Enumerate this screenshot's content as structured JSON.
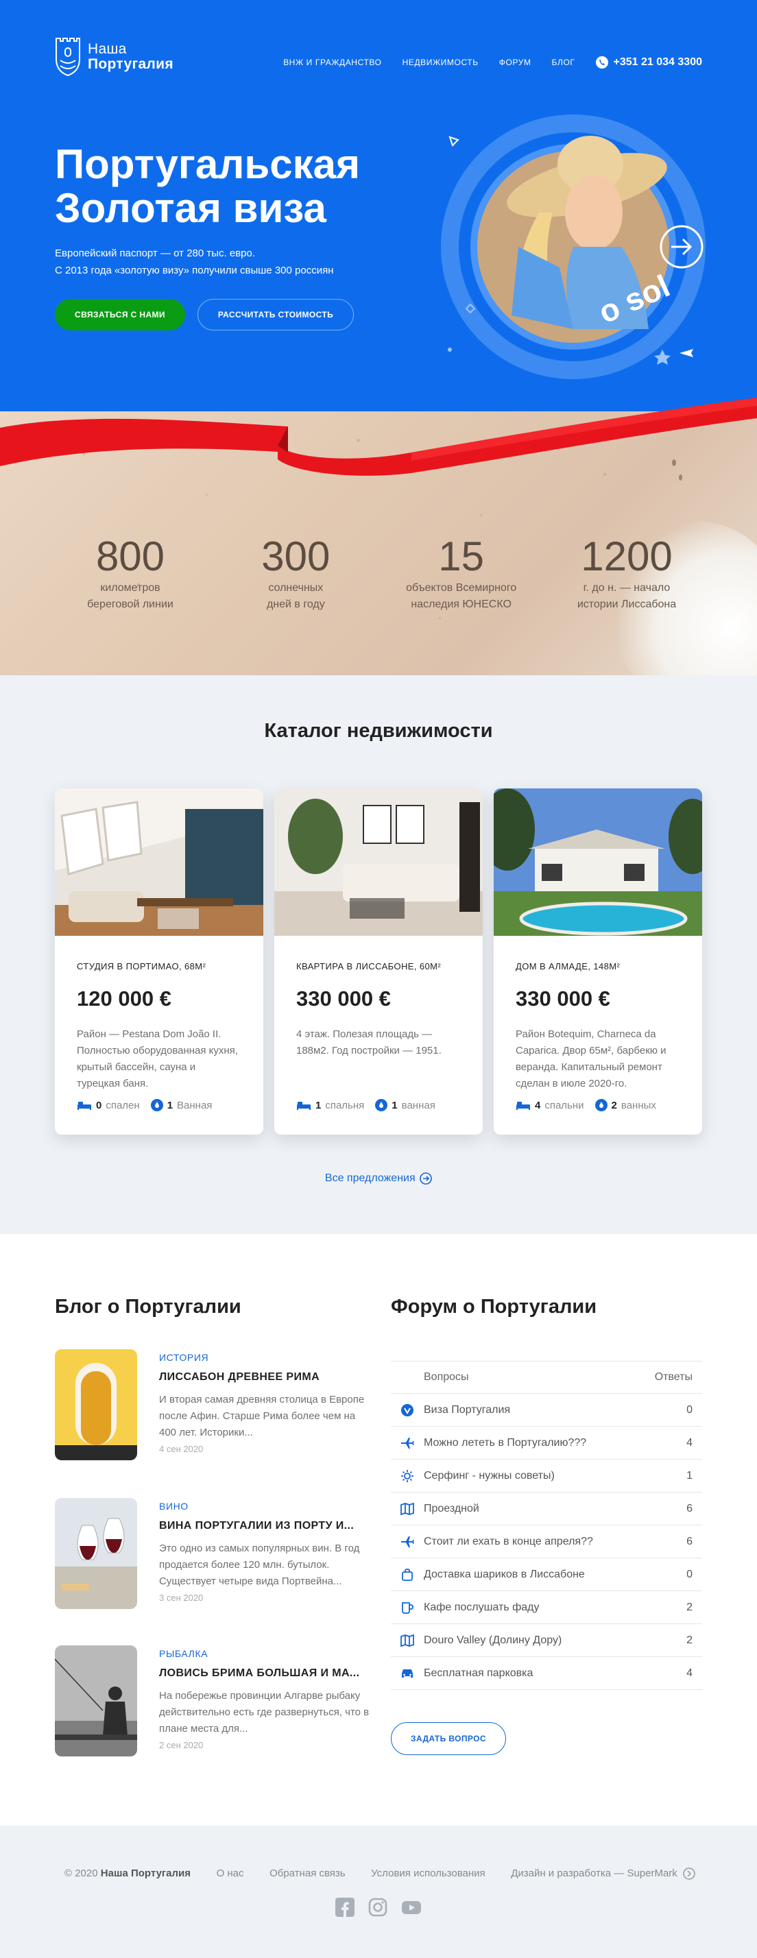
{
  "brand": {
    "line1": "Наша",
    "line2": "Португалия"
  },
  "nav": {
    "items": [
      "ВНЖ И ГРАЖДАНСТВО",
      "НЕДВИЖИМОСТЬ",
      "ФОРУМ",
      "БЛОГ"
    ],
    "phone": "+351 21 034 3300"
  },
  "hero": {
    "title": "Португальская Золотая виза",
    "subtitle_line1": "Европейский паспорт — от 280 тыс. евро.",
    "subtitle_line2": "С 2013 года «золотую визу» получили свыше 300 россиян",
    "btn_contact": "СВЯЗАТЬСЯ С НАМИ",
    "btn_calc": "РАССЧИТАТЬ СТОИМОСТЬ",
    "circle_text": "o sol"
  },
  "stats": [
    {
      "num": "800",
      "line1": "километров",
      "line2": "береговой линии"
    },
    {
      "num": "300",
      "line1": "солнечных",
      "line2": "дней в году"
    },
    {
      "num": "15",
      "line1": "объектов Всемирного",
      "line2": "наследия ЮНЕСКО"
    },
    {
      "num": "1200",
      "line1": "г. до н. — начало",
      "line2": "истории Лиссабона"
    }
  ],
  "catalog": {
    "title": "Каталог недвижимости",
    "all_link": "Все предложения",
    "cards": [
      {
        "title": "СТУДИЯ В ПОРТИМАО, 68М²",
        "price": "120 000 €",
        "desc": "Район — Pestana Dom João II. Полностью оборудованная кухня, крытый бассейн, сауна и турецкая баня.",
        "beds": "0",
        "beds_label": "спален",
        "baths": "1",
        "baths_label": "Ванная"
      },
      {
        "title": "КВАРТИРА В ЛИССАБОНЕ, 60М²",
        "price": "330 000 €",
        "desc": "4 этаж. Полезая площадь — 188м2. Год постройки — 1951.",
        "beds": "1",
        "beds_label": "спальня",
        "baths": "1",
        "baths_label": "ванная"
      },
      {
        "title": "ДОМ В АЛМАДЕ, 148М²",
        "price": "330 000 €",
        "desc": "Район Botequim, Charneca da Caparica. Двор 65м², барбекю и веранда. Капитальный ремонт сделан в июле 2020-го.",
        "beds": "4",
        "beds_label": "спальни",
        "baths": "2",
        "baths_label": "ванных"
      }
    ]
  },
  "blog": {
    "title": "Блог о Португалии",
    "posts": [
      {
        "category": "ИСТОРИЯ",
        "title": "ЛИССАБОН ДРЕВНЕЕ РИМА",
        "text": "И вторая самая древняя столица в Европе после Афин. Старше Рима более чем на 400 лет. Историки...",
        "date": "4 сен 2020"
      },
      {
        "category": "ВИНО",
        "title": "ВИНА ПОРТУГАЛИИ ИЗ ПОРТУ И...",
        "text": "Это одно из самых популярных вин. В год продается более 120 млн. бутылок. Существует четыре вида Портвейна...",
        "date": "3 сен 2020"
      },
      {
        "category": "РЫБАЛКА",
        "title": "ЛОВИСЬ БРИМА БОЛЬШАЯ И МА...",
        "text": "На побережье провинции Алгарве рыбаку действительно есть где развернуться, что в плане места для...",
        "date": "2 сен 2020"
      }
    ]
  },
  "forum": {
    "title": "Форум о Португалии",
    "col_questions": "Вопросы",
    "col_answers": "Ответы",
    "rows": [
      {
        "icon": "badge-v-icon",
        "q": "Виза Португалия",
        "a": "0"
      },
      {
        "icon": "plane-icon",
        "q": "Можно лететь в Португалию???",
        "a": "4"
      },
      {
        "icon": "sun-icon",
        "q": "Серфинг - нужны советы)",
        "a": "1"
      },
      {
        "icon": "map-icon",
        "q": "Проездной",
        "a": "6"
      },
      {
        "icon": "plane-icon",
        "q": "Стоит ли ехать в конце апреля??",
        "a": "6"
      },
      {
        "icon": "bag-icon",
        "q": "Доставка шариков в Лиссабоне",
        "a": "0"
      },
      {
        "icon": "cup-icon",
        "q": "Кафе послушать фаду",
        "a": "2"
      },
      {
        "icon": "map-icon",
        "q": "Douro Valley (Долину Дору)",
        "a": "2"
      },
      {
        "icon": "car-icon",
        "q": "Бесплатная парковка",
        "a": "4"
      }
    ],
    "ask_button": "ЗАДАТЬ ВОПРОС"
  },
  "footer": {
    "copyright": "© 2020",
    "brand": "Наша Португалия",
    "about": "О нас",
    "feedback": "Обратная связь",
    "terms": "Условия использования",
    "credits": "Дизайн и разработка — SuperMark"
  },
  "colors": {
    "primary": "#0e6cec",
    "accent_green": "#0a9d14",
    "link": "#1566d6",
    "ribbon_red": "#e8141c"
  }
}
